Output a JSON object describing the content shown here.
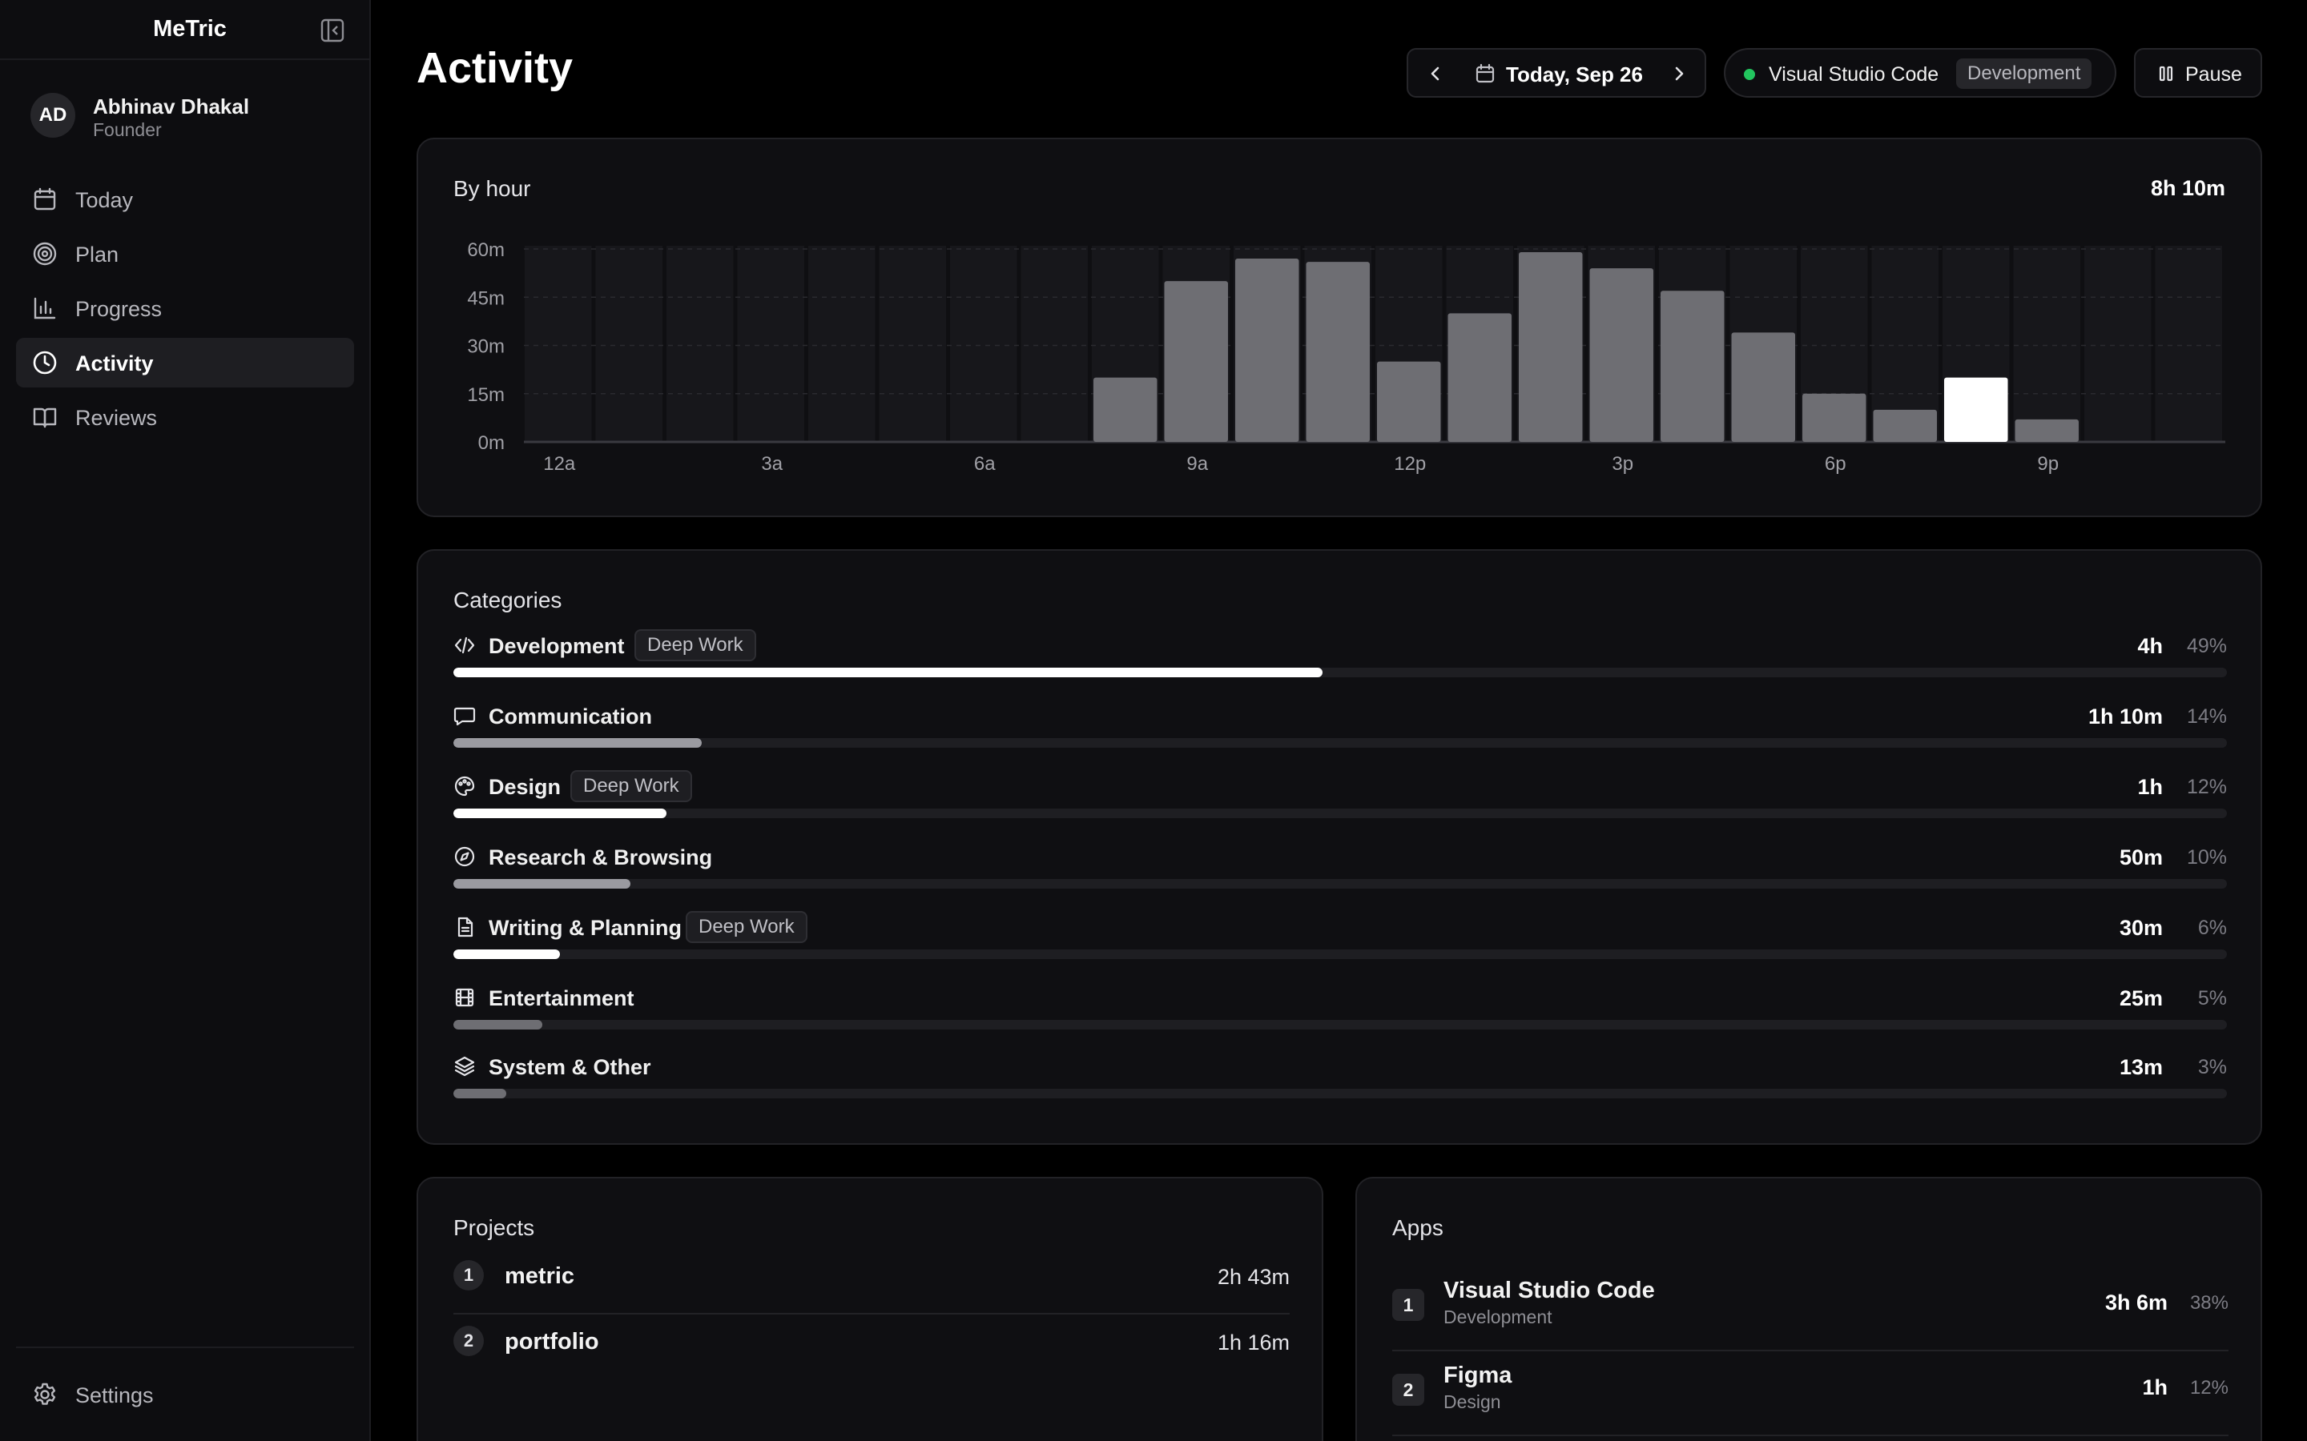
{
  "app": {
    "title": "MeTric"
  },
  "user": {
    "initials": "AD",
    "name": "Abhinav Dhakal",
    "role": "Founder"
  },
  "nav": {
    "items": [
      {
        "label": "Today",
        "icon": "calendar-icon"
      },
      {
        "label": "Plan",
        "icon": "target-icon"
      },
      {
        "label": "Progress",
        "icon": "bar-chart-icon"
      },
      {
        "label": "Activity",
        "icon": "clock-icon",
        "active": true
      },
      {
        "label": "Reviews",
        "icon": "book-icon"
      }
    ],
    "settings_label": "Settings"
  },
  "header": {
    "title": "Activity",
    "date_label": "Today, Sep 26",
    "tracking_app": "Visual Studio Code",
    "tracking_category": "Development",
    "pause_label": "Pause"
  },
  "by_hour": {
    "title": "By hour",
    "total": "8h 10m",
    "chart_data": {
      "type": "bar",
      "x": [
        0,
        1,
        2,
        3,
        4,
        5,
        6,
        7,
        8,
        9,
        10,
        11,
        12,
        13,
        14,
        15,
        16,
        17,
        18,
        19,
        20,
        21,
        22,
        23
      ],
      "x_tick_labels": [
        "12a",
        "3a",
        "6a",
        "9a",
        "12p",
        "3p",
        "6p",
        "9p"
      ],
      "x_tick_positions": [
        0,
        3,
        6,
        9,
        12,
        15,
        18,
        21
      ],
      "values": [
        0,
        0,
        0,
        0,
        0,
        0,
        0,
        0,
        20,
        50,
        57,
        56,
        25,
        40,
        59,
        54,
        47,
        34,
        15,
        10,
        20,
        7,
        0,
        0
      ],
      "highlight_index": 20,
      "ylabel": "",
      "y_tick_labels": [
        "0m",
        "15m",
        "30m",
        "45m",
        "60m"
      ],
      "ylim": [
        0,
        60
      ],
      "grid": true,
      "colors": {
        "bar": "#6e6e73",
        "highlight": "#ffffff",
        "slot": "#17171b"
      }
    }
  },
  "categories": {
    "title": "Categories",
    "items": [
      {
        "name": "Development",
        "tag": "Deep Work",
        "duration": "4h",
        "percent": "49%",
        "value": 49,
        "icon": "code-icon",
        "color": "#ffffff"
      },
      {
        "name": "Communication",
        "tag": "",
        "duration": "1h 10m",
        "percent": "14%",
        "value": 14,
        "icon": "message-icon",
        "color": "#9a9aa0"
      },
      {
        "name": "Design",
        "tag": "Deep Work",
        "duration": "1h",
        "percent": "12%",
        "value": 12,
        "icon": "palette-icon",
        "color": "#ffffff"
      },
      {
        "name": "Research & Browsing",
        "tag": "",
        "duration": "50m",
        "percent": "10%",
        "value": 10,
        "icon": "compass-icon",
        "color": "#9a9aa0"
      },
      {
        "name": "Writing & Planning",
        "tag": "Deep Work",
        "duration": "30m",
        "percent": "6%",
        "value": 6,
        "icon": "document-icon",
        "color": "#ffffff"
      },
      {
        "name": "Entertainment",
        "tag": "",
        "duration": "25m",
        "percent": "5%",
        "value": 5,
        "icon": "film-icon",
        "color": "#6e6e73"
      },
      {
        "name": "System & Other",
        "tag": "",
        "duration": "13m",
        "percent": "3%",
        "value": 3,
        "icon": "layers-icon",
        "color": "#6e6e73"
      }
    ]
  },
  "projects": {
    "title": "Projects",
    "items": [
      {
        "rank": "1",
        "name": "metric",
        "duration": "2h 43m"
      },
      {
        "rank": "2",
        "name": "portfolio",
        "duration": "1h 16m"
      }
    ]
  },
  "apps": {
    "title": "Apps",
    "items": [
      {
        "rank": "1",
        "name": "Visual Studio Code",
        "category": "Development",
        "duration": "3h 6m",
        "percent": "38%"
      },
      {
        "rank": "2",
        "name": "Figma",
        "category": "Design",
        "duration": "1h",
        "percent": "12%"
      }
    ]
  }
}
